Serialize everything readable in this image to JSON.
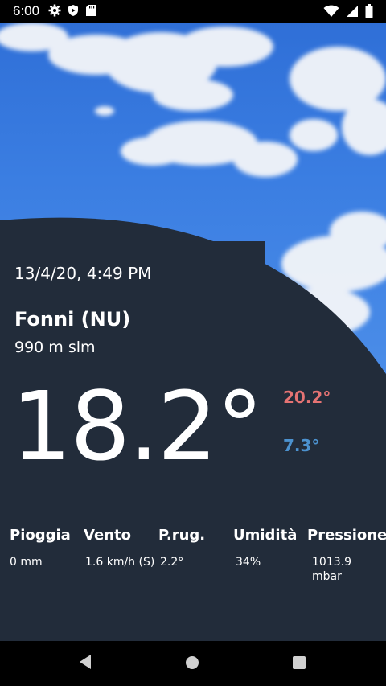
{
  "status_bar": {
    "time": "6:00"
  },
  "weather": {
    "datetime": "13/4/20, 4:49 PM",
    "city": "Fonni (NU)",
    "altitude": "990 m slm",
    "temperature": "18.2°",
    "temp_max": "20.2°",
    "temp_min": "7.3°",
    "colors": {
      "max": "#e57373",
      "min": "#4c92cf",
      "panel": "#222c3a"
    }
  },
  "metrics": [
    {
      "label": "Pioggia",
      "value": "0 mm"
    },
    {
      "label": "Vento",
      "value": "1.6 km/h (S)"
    },
    {
      "label": "P.rug.",
      "value": "2.2°"
    },
    {
      "label": "Umidità",
      "value": "34%"
    },
    {
      "label": "Pressione",
      "value": "1013.9 mbar"
    }
  ],
  "nav": {
    "icons": [
      "back-icon",
      "home-icon",
      "recents-icon"
    ]
  }
}
